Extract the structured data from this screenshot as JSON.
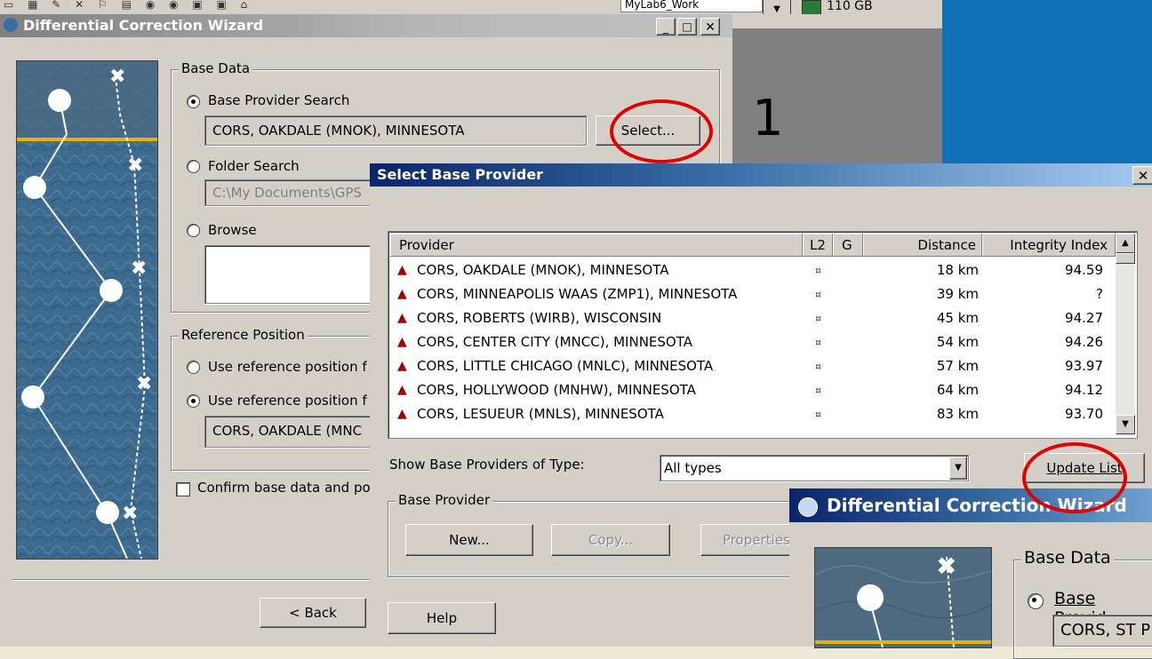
{
  "toolbar": {
    "doc_label": "MyLab6_Work",
    "disk_label": "110 GB"
  },
  "annotation_number": "1",
  "wizard": {
    "title": "Differential Correction Wizard",
    "base_data_label": "Base Data",
    "base_provider_search": "Base Provider Search",
    "base_provider_value": "CORS, OAKDALE (MNOK),  MINNESOTA",
    "select_button": "Select...",
    "folder_search": "Folder Search",
    "folder_value": "C:\\My Documents\\GPS",
    "browse": "Browse",
    "ref_position_label": "Reference Position",
    "ref_option_1": "Use reference position f",
    "ref_option_2": "Use reference position f",
    "ref_value": "CORS, OAKDALE (MNC",
    "confirm": "Confirm base data and po",
    "back_button": "< Back"
  },
  "select_dialog": {
    "title": "Select Base Provider",
    "columns": [
      "Provider",
      "L2",
      "G",
      "Distance",
      "Integrity Index"
    ],
    "rows": [
      {
        "provider": "CORS, OAKDALE (MNOK),  MINNESOTA",
        "l2": "¤",
        "distance": "18 km",
        "integrity": "94.59"
      },
      {
        "provider": "CORS, MINNEAPOLIS WAAS (ZMP1),  MINNESOTA",
        "l2": "¤",
        "distance": "39 km",
        "integrity": "?"
      },
      {
        "provider": "CORS, ROBERTS (WIRB),  WISCONSIN",
        "l2": "¤",
        "distance": "45 km",
        "integrity": "94.27"
      },
      {
        "provider": "CORS, CENTER CITY (MNCC),  MINNESOTA",
        "l2": "¤",
        "distance": "54 km",
        "integrity": "94.26"
      },
      {
        "provider": "CORS, LITTLE CHICAGO (MNLC),  MINNESOTA",
        "l2": "¤",
        "distance": "57 km",
        "integrity": "93.97"
      },
      {
        "provider": "CORS, HOLLYWOOD (MNHW),  MINNESOTA",
        "l2": "¤",
        "distance": "64 km",
        "integrity": "94.12"
      },
      {
        "provider": "CORS, LESUEUR (MNLS),  MINNESOTA",
        "l2": "¤",
        "distance": "83 km",
        "integrity": "93.70"
      }
    ],
    "show_types_label": "Show Base Providers of Type:",
    "type_value": "All types",
    "update_button": "Update List",
    "base_provider_group": "Base Provider",
    "new_button": "New...",
    "copy_button": "Copy...",
    "properties_button": "Properties...",
    "help_button": "Help",
    "close_glyph": "X"
  },
  "wizard2": {
    "title": "Differential Correction Wizard",
    "base_data_label": "Base Data",
    "base_provider_search": "Base Provid",
    "value": "CORS, ST P"
  },
  "colors": {
    "title_active": "#0a246a",
    "title_gradient_end": "#a6caf0",
    "annotation_ring": "#e00000"
  }
}
